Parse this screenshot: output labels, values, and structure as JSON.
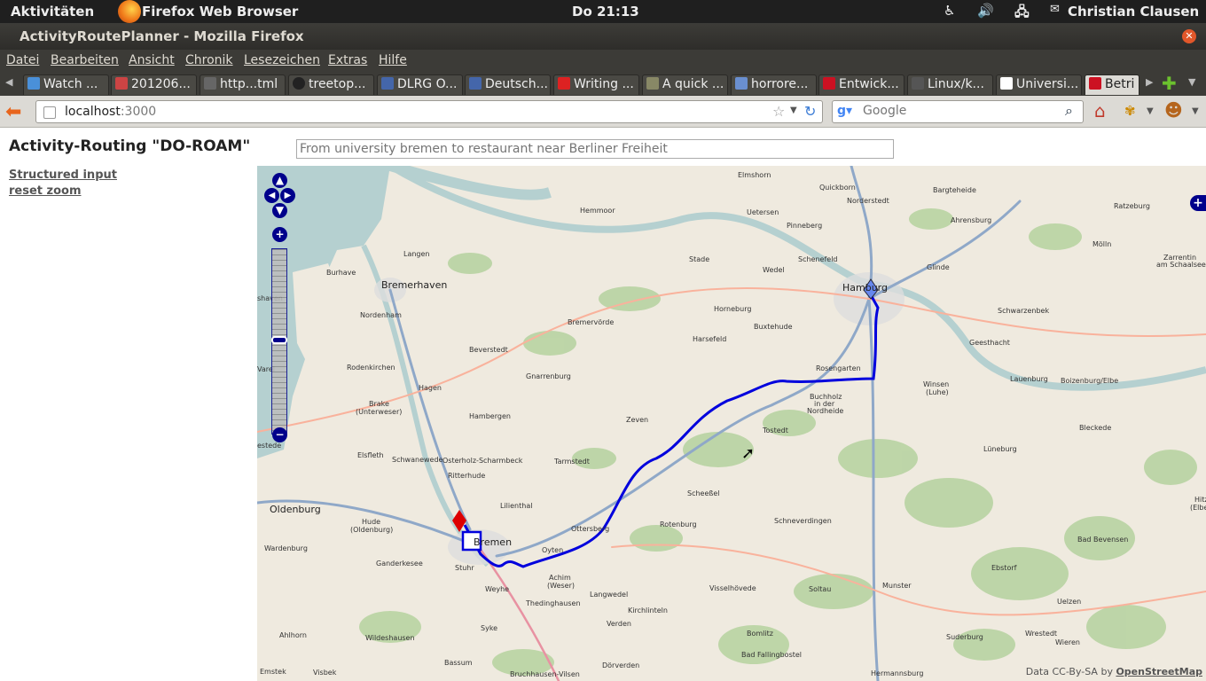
{
  "topbar": {
    "activities": "Aktivitäten",
    "app_name": "Firefox Web Browser",
    "clock": "Do 21:13",
    "user": "Christian Clausen"
  },
  "window": {
    "title": "ActivityRoutePlanner - Mozilla Firefox"
  },
  "menu": [
    "Datei",
    "Bearbeiten",
    "Ansicht",
    "Chronik",
    "Lesezeichen",
    "Extras",
    "Hilfe"
  ],
  "tabs": [
    {
      "label": "Watch ..."
    },
    {
      "label": "201206..."
    },
    {
      "label": "http...tml"
    },
    {
      "label": "treetop..."
    },
    {
      "label": "DLRG O..."
    },
    {
      "label": "Deutsch..."
    },
    {
      "label": "Writing ..."
    },
    {
      "label": "A quick ..."
    },
    {
      "label": "horrore..."
    },
    {
      "label": "Entwick..."
    },
    {
      "label": "Linux/k..."
    },
    {
      "label": "Universi..."
    },
    {
      "label": "Betri"
    }
  ],
  "address": {
    "host": "localhost",
    "port": ":3000"
  },
  "search": {
    "placeholder": "Google"
  },
  "app": {
    "title": "Activity-Routing \"DO-ROAM\"",
    "query_placeholder": "From university bremen to restaurant near Berliner Freiheit",
    "link_structured": "Structured input",
    "link_reset": "reset zoom"
  },
  "map": {
    "attribution_prefix": "Data CC-By-SA by ",
    "attribution_link": "OpenStreetMap",
    "route_color": "#0000dd",
    "start_marker_color": "#dd0000",
    "end_marker_color": "#6688ee",
    "places": {
      "bremerhaven": "Bremerhaven",
      "bremen": "Bremen",
      "hamburg": "Hamburg",
      "oldenburg": "Oldenburg",
      "elmshorn": "Elmshorn",
      "quickborn": "Quickborn",
      "norderstedt": "Norderstedt",
      "bargteheide": "Bargteheide",
      "ratzeburg": "Ratzeburg",
      "uetersen": "Uetersen",
      "hemmoor": "Hemmoor",
      "ahrensburg": "Ahrensburg",
      "pinneberg": "Pinneberg",
      "langen": "Langen",
      "stade": "Stade",
      "schenefeld": "Schenefeld",
      "wedel": "Wedel",
      "glinde": "Glinde",
      "molln": "Mölln",
      "zarrentin": "Zarrentin",
      "zarrentin2": "am Schaalsee",
      "burhave": "Burhave",
      "nordenham": "Nordenham",
      "bremervorde": "Bremervörde",
      "horneburg": "Horneburg",
      "buxtehude": "Buxtehude",
      "schwarzenbek": "Schwarzenbek",
      "harsefeld": "Harsefeld",
      "geesthacht": "Geesthacht",
      "beverstedt": "Beverstedt",
      "rodenkirchen": "Rodenkirchen",
      "rosengarten": "Rosengarten",
      "lauenburg": "Lauenburg",
      "gnarrenburg": "Gnarrenburg",
      "hagen": "Hagen",
      "winsen": "Winsen",
      "winsen2": "(Luhe)",
      "boizenburg": "Boizenburg/Elbe",
      "buchholz": "Buchholz",
      "buchholz2": "in der",
      "buchholz3": "Nordheide",
      "brake": "Brake",
      "brake2": "(Unterweser)",
      "hambergen": "Hambergen",
      "zeven": "Zeven",
      "tostedt": "Tostedt",
      "bleckede": "Bleckede",
      "elsfleth": "Elsfleth",
      "schwanewede": "Schwanewede",
      "osterholz": "Osterholz-Scharmbeck",
      "tarmstedt": "Tarmstedt",
      "luneburg": "Lüneburg",
      "ritterhude": "Ritterhude",
      "scheessel": "Scheeßel",
      "lilienthal": "Lilienthal",
      "hude": "Hude",
      "hude2": "(Oldenburg)",
      "schneverdingen": "Schneverdingen",
      "ottersberg": "Ottersberg",
      "rotenburg": "Rotenburg",
      "wardenburg": "Wardenburg",
      "badbevensen": "Bad Bevensen",
      "ganderkesee": "Ganderkesee",
      "oyten": "Oyten",
      "ebstorf": "Ebstorf",
      "stuhr": "Stuhr",
      "achim": "Achim",
      "achim2": "(Weser)",
      "weyhe": "Weyhe",
      "visselhoevede": "Visselhövede",
      "soltau": "Soltau",
      "munster": "Munster",
      "langwedel": "Langwedel",
      "thedinghausen": "Thedinghausen",
      "uelzen": "Uelzen",
      "kirchlinteln": "Kirchlinteln",
      "verden": "Verden",
      "ahlhorn": "Ahlhorn",
      "wildeshausen": "Wildeshausen",
      "syke": "Syke",
      "bomlitz": "Bomlitz",
      "suderburg": "Suderburg",
      "wrestedt": "Wrestedt",
      "wieren": "Wieren",
      "bassum": "Bassum",
      "badfallingbostel": "Bad Fallingbostel",
      "emstek": "Emstek",
      "visbek": "Visbek",
      "bruchhausen": "Bruchhausen-Vilsen",
      "dorverden": "Dörverden",
      "hermannsburg": "Hermannsburg",
      "hitz": "Hitz",
      "hitz2": "(Elbe)",
      "estede": "estede",
      "shaven": "shaven",
      "varel": "Varel"
    }
  }
}
